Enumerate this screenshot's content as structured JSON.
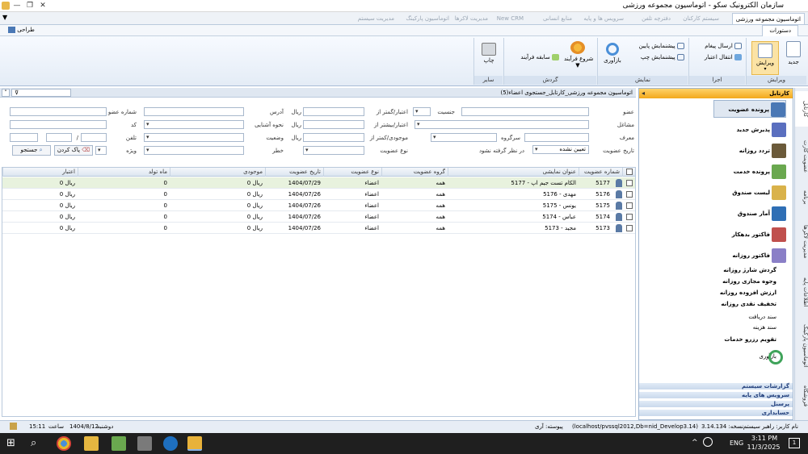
{
  "window": {
    "title": "سازمان الکترونیک سکو - اتوماسیون مجموعه ورزشی",
    "min": "—",
    "max": "❐",
    "close": "✕"
  },
  "module_tabs": [
    {
      "label": "اتوماسیون مجموعه ورزشی",
      "active": true
    },
    {
      "label": "سیستم کارکنان",
      "active": false
    },
    {
      "label": "دفترچه تلفن",
      "active": false
    },
    {
      "label": "سرویس ها و پایه",
      "active": false
    },
    {
      "label": "منابع انسانی",
      "active": false
    },
    {
      "label": "New CRM",
      "active": false
    },
    {
      "label": "مدیریت لاکرها",
      "active": false
    },
    {
      "label": "اتوماسیون پارکینگ",
      "active": false
    },
    {
      "label": "مدیریت سیستم",
      "active": false
    }
  ],
  "subbar": {
    "commands": "دستورات",
    "designer": "طراحی"
  },
  "ribbon": {
    "groups": {
      "edit": "ویرایش",
      "execute": "اجرا",
      "view": "نمایش",
      "workflow": "گردش",
      "other": "سایر"
    },
    "buttons": {
      "new": "جدید",
      "edit": "ویرایش",
      "send_message": "ارسال پیغام",
      "transfer_credit": "انتقال اعتبار",
      "reload": "بازآوری",
      "preview_bottom": "پیشنمایش پایین",
      "preview_left": "پیشنمایش چپ",
      "start_process": "شروع فرآیند",
      "process_history": "سابقه فرآیند",
      "print": "چاپ"
    }
  },
  "breadcrumb": "اتوماسیون مجموعه ورزشی_کارتابل_جستجوی اعضاء(5)",
  "filters": {
    "member_no": "شماره عضو",
    "address": "آدرس",
    "credit_from": "اعتبار/گمتر از",
    "gender": "جنسیت",
    "member": "عضو",
    "code": "کد",
    "familiarity": "نحوه آشنایی",
    "credit_to": "اعتبار/بیشتر از",
    "job": "مشاغل",
    "phone": "تلفن",
    "status": "وضعیت",
    "balance_from": "موجودی/کمتر از",
    "group_head": "سرگروه",
    "introducer": "معرف",
    "special": "ویژه",
    "hazard": "خطر",
    "member_type": "نوع عضویت",
    "membership_date": "تاریخ عضویت",
    "date_mode": "تعیین نشده",
    "ignore": "در نظر گرفته نشود",
    "currency": "ریال",
    "search_btn": "جستجو",
    "clear_btn": "پاک کردن",
    "slash": "/"
  },
  "grid": {
    "columns": [
      "شماره عضویت",
      "عنوان نمایشی",
      "گروه عضویت",
      "نوع عضویت",
      "تاریخ عضویت",
      "موجودی",
      "ماه تولد",
      "اعتبار"
    ],
    "rows": [
      {
        "no": "5177",
        "name": "5177 - الکام تست جیم اپ",
        "group": "همه",
        "type": "اعضاء",
        "date": "1404/07/29",
        "balance": "0 ریال",
        "month": "0",
        "credit": "0 ریال"
      },
      {
        "no": "5176",
        "name": "5176 - مهدی",
        "group": "همه",
        "type": "اعضاء",
        "date": "1404/07/26",
        "balance": "0 ریال",
        "month": "0",
        "credit": "0 ریال"
      },
      {
        "no": "5175",
        "name": "5175 - یونس",
        "group": "همه",
        "type": "اعضاء",
        "date": "1404/07/26",
        "balance": "0 ریال",
        "month": "0",
        "credit": "0 ریال"
      },
      {
        "no": "5174",
        "name": "5174 - عباس",
        "group": "همه",
        "type": "اعضاء",
        "date": "1404/07/26",
        "balance": "0 ریال",
        "month": "0",
        "credit": "0 ریال"
      },
      {
        "no": "5173",
        "name": "5173 - مجید",
        "group": "همه",
        "type": "اعضاء",
        "date": "1404/07/26",
        "balance": "0 ریال",
        "month": "0",
        "credit": "0 ریال"
      }
    ]
  },
  "sidebar": {
    "header": "کارتابل",
    "big_items": [
      "پرونده عضویت",
      "پذیرش جدید",
      "تردد روزانه",
      "پرونده خدمت",
      "لیست صندوق",
      "آمار صندوق",
      "فاکتور بدهکار",
      "فاکتور روزانه"
    ],
    "small_items": [
      "گردش شارژ روزانه",
      "وجوه مجازی روزانه",
      "ارزش افزوده روزانه",
      "تخفیف نقدی روزانه"
    ],
    "plain_items": [
      "سند دریافت",
      "سند هزینه"
    ],
    "bold_item": "تقویم رزرو خدمات",
    "reload": "بازآوری",
    "bottom_bars": [
      "گزارشات سیستم",
      "سرویس های پایه",
      "پرسنل",
      "حسابداری"
    ]
  },
  "vtabs": [
    "کارتابل",
    "عضویت کارت",
    "برنامه",
    "مدیریت لاکرها",
    "اطلاعات پایه",
    "اتوماسیون پارکینگ",
    "فروشگاه"
  ],
  "status": {
    "user": "نام کاربر: راهبر سیستم",
    "version": "نسخه: 3.14.134",
    "conn": "(localhost/pvssql2012,Db=nid_Develop3.14)",
    "ok": "پیوسته: آری",
    "day": "دوشنبه",
    "date": "1404/8/12",
    "time_label": "ساعت",
    "time": "15:11"
  },
  "taskbar": {
    "time": "3:11 PM",
    "date": "11/3/2025",
    "lang": "ENG",
    "notif": "1"
  }
}
